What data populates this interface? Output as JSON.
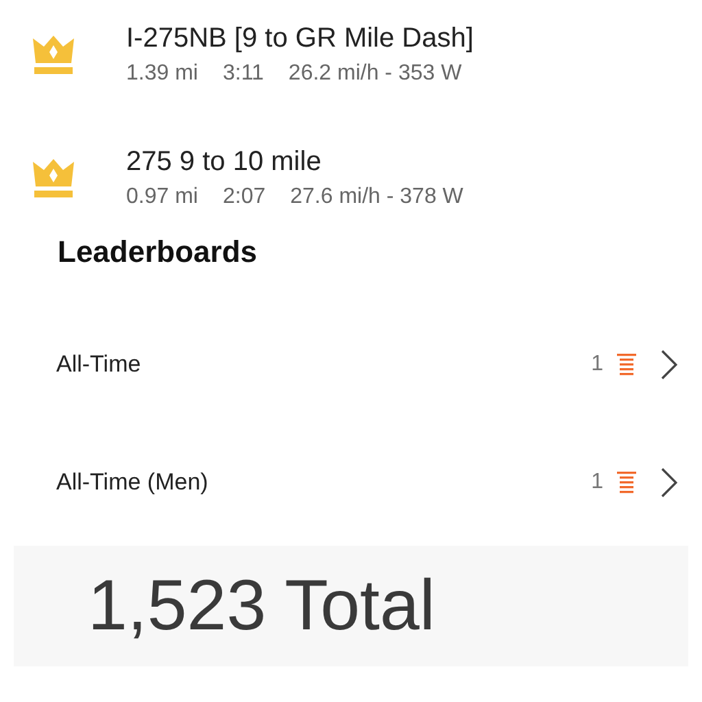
{
  "segments": [
    {
      "name": "I-275NB [9 to GR Mile Dash]",
      "distance": "1.39 mi",
      "time": "3:11",
      "speed_power": "26.2 mi/h - 353 W"
    },
    {
      "name": "275 9 to 10 mile",
      "distance": "0.97 mi",
      "time": "2:07",
      "speed_power": "27.6 mi/h - 378 W"
    }
  ],
  "leaderboards": {
    "title": "Leaderboards",
    "items": [
      {
        "label": "All-Time",
        "rank": "1"
      },
      {
        "label": "All-Time (Men)",
        "rank": "1"
      }
    ]
  },
  "total": "1,523 Total"
}
